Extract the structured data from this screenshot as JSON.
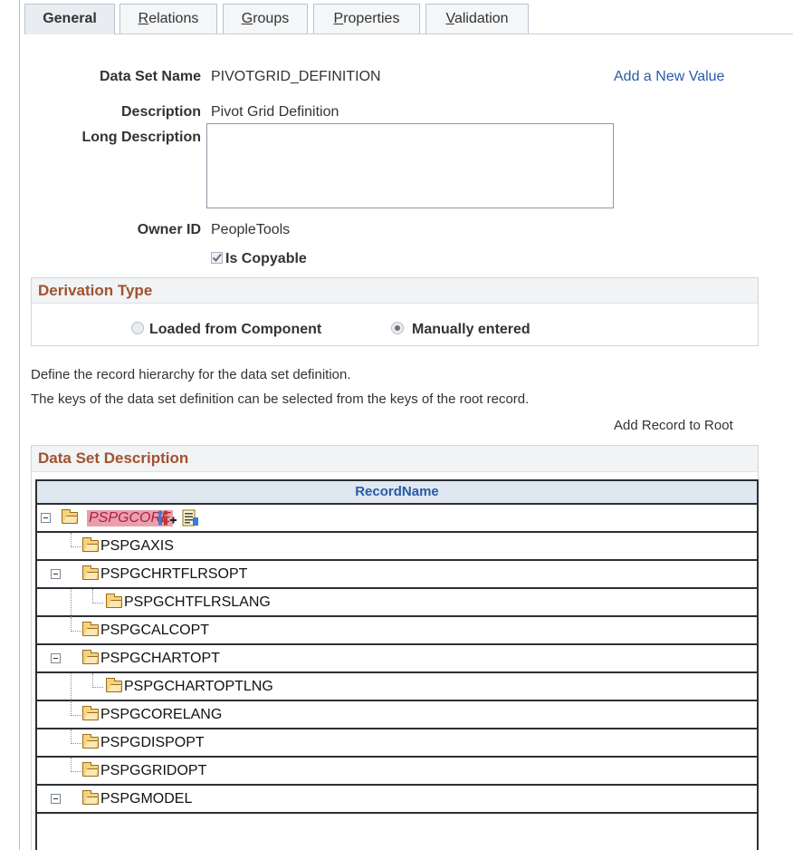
{
  "tabs": [
    {
      "label": "General",
      "accel": "",
      "rest": "General",
      "active": true
    },
    {
      "label": "Relations",
      "accel": "R",
      "rest": "elations"
    },
    {
      "label": "Groups",
      "accel": "G",
      "rest": "roups"
    },
    {
      "label": "Properties",
      "accel": "P",
      "rest": "roperties"
    },
    {
      "label": "Validation",
      "accel": "V",
      "rest": "alidation"
    }
  ],
  "form": {
    "data_set_name_label": "Data Set Name",
    "data_set_name_value": "PIVOTGRID_DEFINITION",
    "add_new_value": "Add a New Value",
    "description_label": "Description",
    "description_value": "Pivot Grid Definition",
    "long_description_label": "Long Description",
    "long_description_value": "",
    "owner_id_label": "Owner ID",
    "owner_id_value": "PeopleTools",
    "is_copyable_label": "Is Copyable",
    "is_copyable_checked": true
  },
  "derivation": {
    "title": "Derivation Type",
    "option_component": "Loaded from Component",
    "option_manual": "Manually entered",
    "selected": "manual"
  },
  "info": {
    "line1": "Define the record hierarchy for the data set definition.",
    "line2": "The keys of the data set definition can be selected from the keys of the root record.",
    "add_record_to_root": "Add Record to Root"
  },
  "dataset": {
    "title": "Data Set Description",
    "column_header": "RecordName",
    "root": "PSPGCORE",
    "records": [
      "PSPGAXIS",
      "PSPGCHRTFLRSOPT",
      "PSPGCHTFLRSLANG",
      "PSPGCALCOPT",
      "PSPGCHARTOPT",
      "PSPGCHARTOPTLNG",
      "PSPGCORELANG",
      "PSPGDISPOPT",
      "PSPGGRIDOPT",
      "PSPGMODEL"
    ]
  },
  "colors": {
    "link": "#2a5ba6",
    "group_title": "#a0522d",
    "root_highlight": "#e8a0ad"
  }
}
